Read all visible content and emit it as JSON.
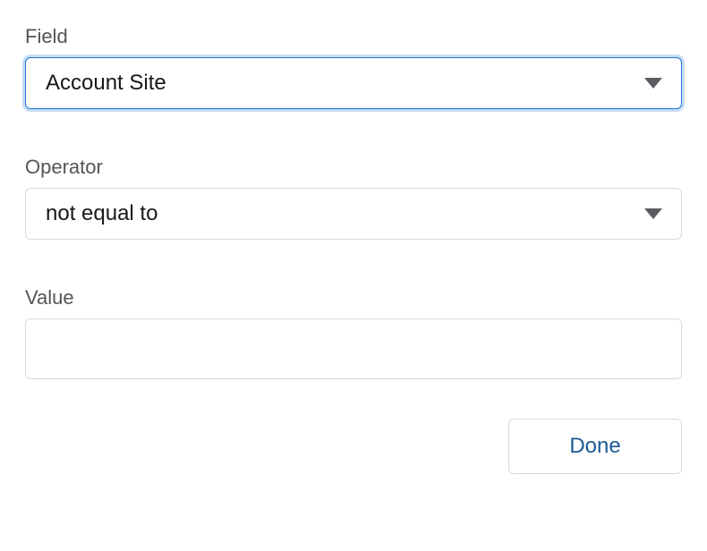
{
  "field": {
    "label": "Field",
    "value": "Account Site"
  },
  "operator": {
    "label": "Operator",
    "value": "not equal to"
  },
  "value": {
    "label": "Value",
    "value": ""
  },
  "footer": {
    "done_label": "Done"
  },
  "colors": {
    "focus_border": "#1b78d0",
    "border": "#d9d9de",
    "label_text": "#54545a",
    "done_text": "#1b5a96"
  }
}
